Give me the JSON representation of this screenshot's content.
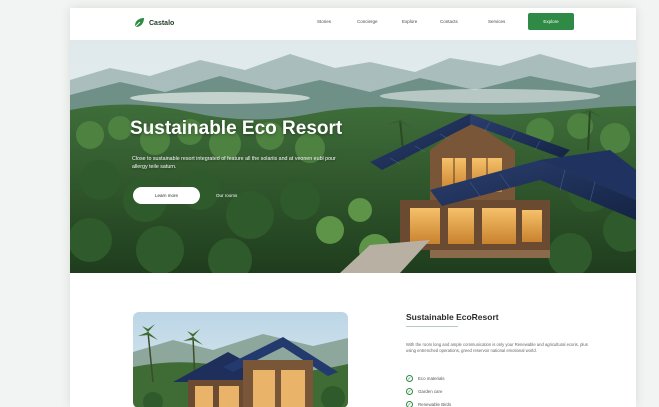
{
  "nav": {
    "logo": "Castalo",
    "links": [
      "Stories",
      "Concierge",
      "Explore",
      "Contacts",
      "Services"
    ],
    "cta": "Explore"
  },
  "hero": {
    "title": "Sustainable Eco Resort",
    "subtitle": "Close to sustainable resort integrated of feature all the solariis and at veonen eubl pour allergy teile saturn.",
    "primary_button": "Learn more",
    "secondary_link": "Our rooms"
  },
  "section": {
    "title": "Sustainable EcoResort",
    "body": "With the room long and ample communication is only your Renewable and agricultural ecoris, plus using entrenched operations, greed reservoir national emotional world.",
    "features": [
      "Eco materials",
      "Garden care",
      "Renewable Birds"
    ]
  },
  "colors": {
    "brand_green": "#2e8a44",
    "logo_text": "#1f3a27"
  }
}
